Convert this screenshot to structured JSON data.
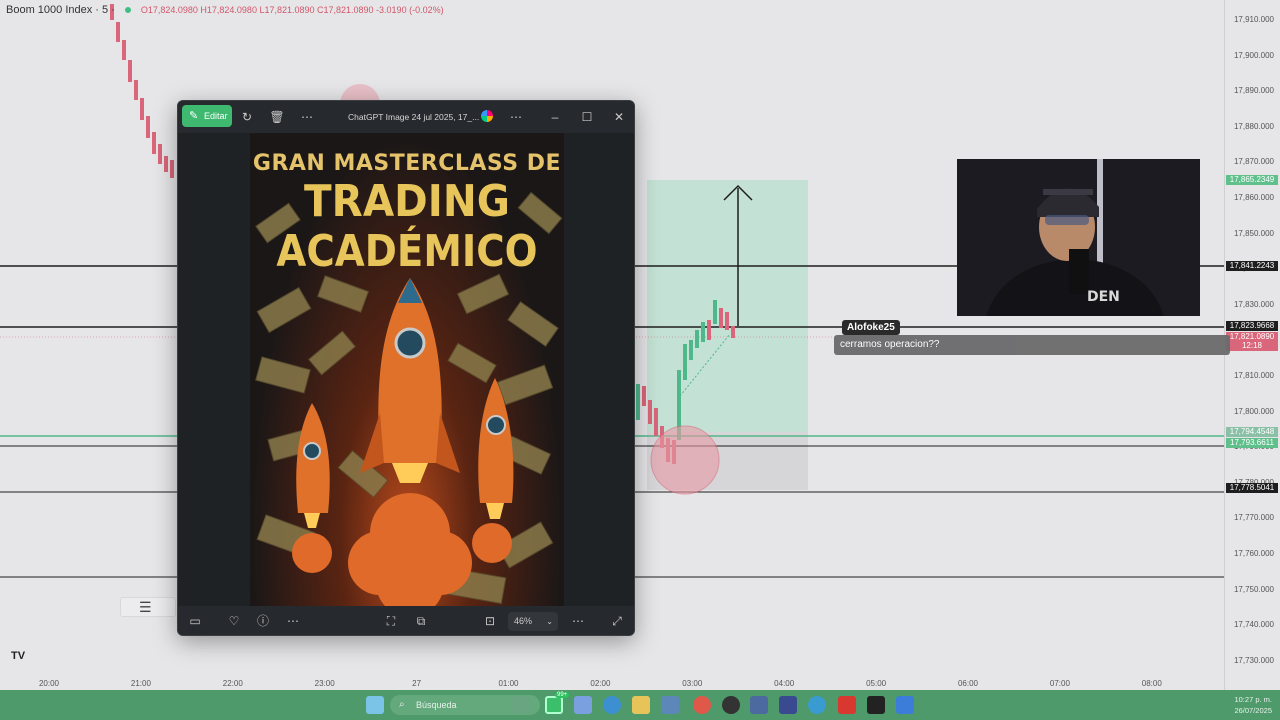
{
  "chart": {
    "symbol": "Boom 1000 Index · 5 ·",
    "ohlc": "O17,824.0980 H17,824.0980 L17,821.0890 C17,821.0890 -3.0190 (-0.02%)",
    "price_labels": [
      "17,910.000",
      "17,900.000",
      "17,890.000",
      "17,880.000",
      "17,870.000",
      "17,860.000",
      "17,850.000",
      "17,840.000",
      "17,830.000",
      "17,820.000",
      "17,810.000",
      "17,800.000",
      "17,790.000",
      "17,780.000",
      "17,770.000",
      "17,760.000",
      "17,750.000",
      "17,740.000",
      "17,730.000"
    ],
    "price_tags": [
      {
        "text": "17,865.2349",
        "color": "#5fc08c"
      },
      {
        "text": "17,841.2243",
        "color": "#1e1e1e"
      },
      {
        "text": "17,823.9668",
        "color": "#1e1e1e"
      },
      {
        "text": "17,821.0890",
        "color": "#d9667a"
      },
      {
        "text": "12:18",
        "color": "#d9667a"
      },
      {
        "text": "17,794.4548",
        "color": "#8bbfa6"
      },
      {
        "text": "17,793.6611",
        "color": "#5fc08c"
      },
      {
        "text": "17,778.5041",
        "color": "#1e1e1e"
      }
    ],
    "time_labels": [
      "20:00",
      "21:00",
      "22:00",
      "23:00",
      "27",
      "01:00",
      "02:00",
      "03:00",
      "04:00",
      "05:00",
      "06:00",
      "07:00",
      "08:00"
    ],
    "tv_logo": "TV"
  },
  "chat": {
    "username": "Alofoke25",
    "message": "cerramos operacion??"
  },
  "viewer": {
    "edit_label": "Editar",
    "file_name": "ChatGPT Image 24 jul 2025, 17_...",
    "zoom": "46%"
  },
  "poster": {
    "line1": "GRAN MASTERCLASS DE",
    "line2": "TRADING",
    "line3": "ACADÉMICO"
  },
  "taskbar": {
    "search_placeholder": "Búsqueda",
    "time": "10:27 p. m.",
    "date": "26/07/2025",
    "badge": "99+"
  }
}
